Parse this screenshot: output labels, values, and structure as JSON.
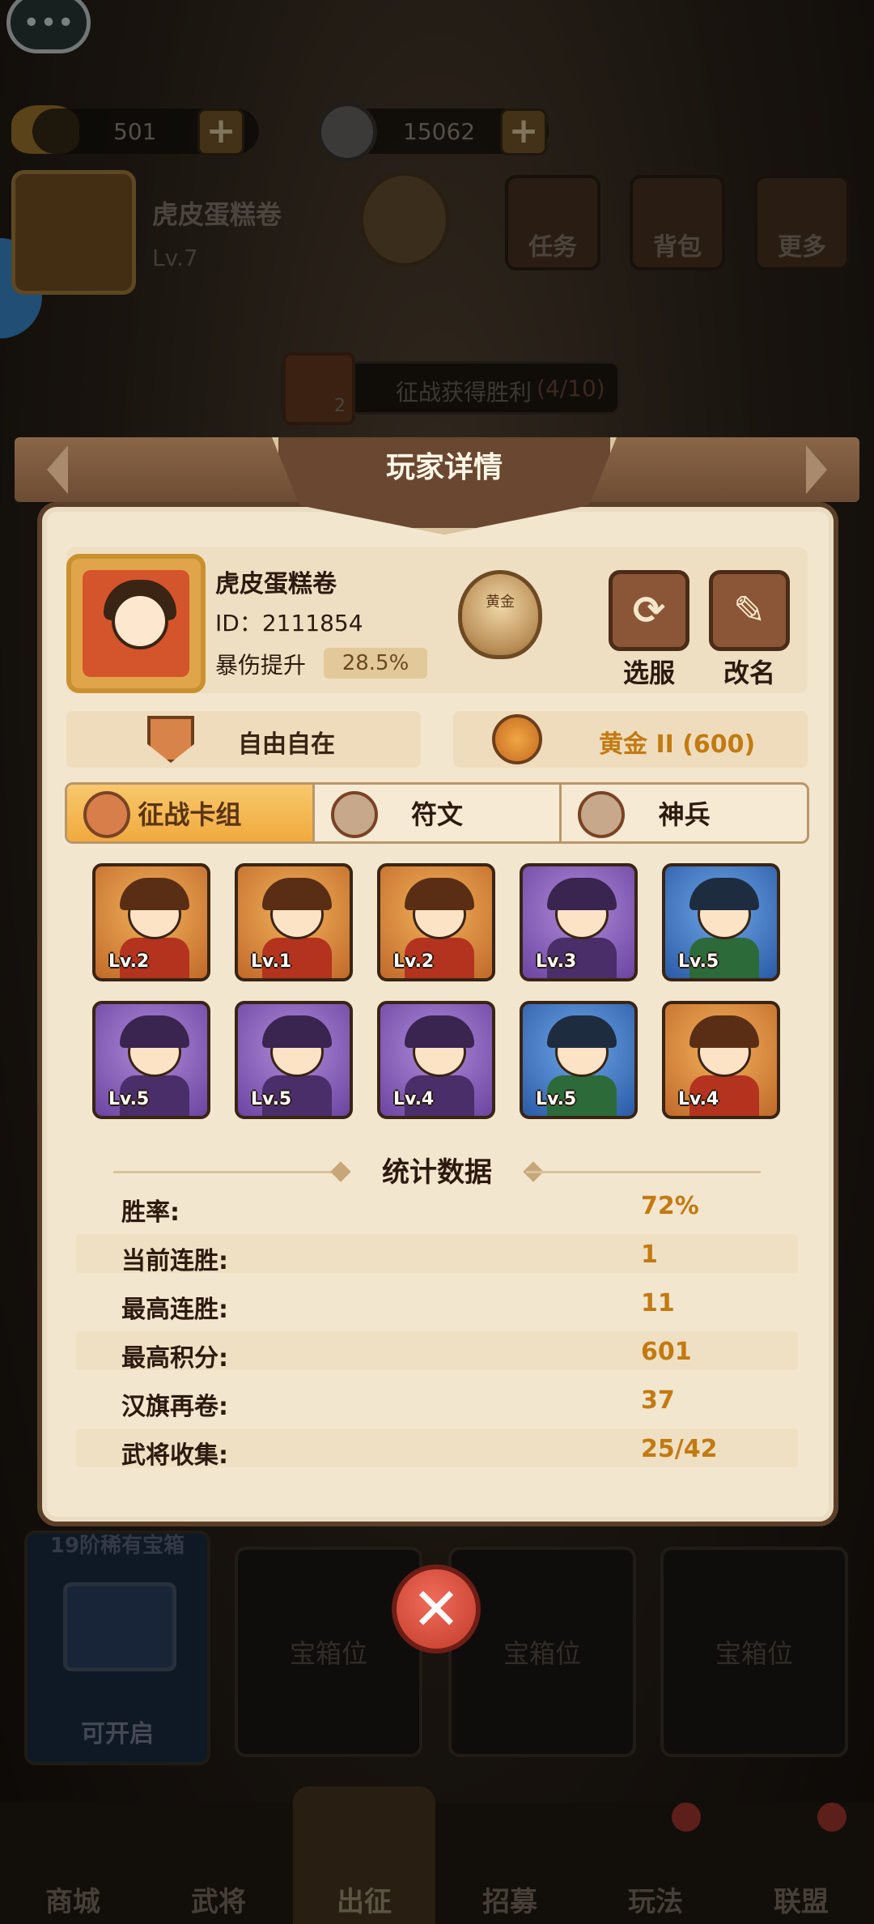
{
  "top": {
    "gold_amount": "501",
    "coin_amount": "15062",
    "player_name": "虎皮蛋糕卷",
    "player_level": "Lv.7",
    "rank_medal_text": "黄金",
    "buttons": [
      "任务",
      "背包",
      "更多"
    ],
    "quest_text": "征战获得胜利",
    "quest_progress": "(4/10)",
    "quest_badge": "2"
  },
  "dialog": {
    "title": "玩家详情",
    "profile": {
      "name": "虎皮蛋糕卷",
      "id": "ID：2111854",
      "stat_label": "暴伤提升",
      "stat_value": "28.5%",
      "medal_text": "黄金",
      "btn_server": "选服",
      "btn_rename": "改名"
    },
    "guild": "自由自在",
    "rank": "黄金 II (600)",
    "tabs": [
      "征战卡组",
      "符文",
      "神兵"
    ],
    "active_tab": 0,
    "cards": [
      {
        "level": "Lv.2",
        "rarity": "orange"
      },
      {
        "level": "Lv.1",
        "rarity": "orange"
      },
      {
        "level": "Lv.2",
        "rarity": "orange"
      },
      {
        "level": "Lv.3",
        "rarity": "purple"
      },
      {
        "level": "Lv.5",
        "rarity": "blue"
      },
      {
        "level": "Lv.5",
        "rarity": "purple"
      },
      {
        "level": "Lv.5",
        "rarity": "purple"
      },
      {
        "level": "Lv.4",
        "rarity": "purple"
      },
      {
        "level": "Lv.5",
        "rarity": "blue"
      },
      {
        "level": "Lv.4",
        "rarity": "orange"
      }
    ],
    "stats_title": "统计数据",
    "stats": [
      {
        "label": "胜率:",
        "value": "72%"
      },
      {
        "label": "当前连胜:",
        "value": "1"
      },
      {
        "label": "最高连胜:",
        "value": "11"
      },
      {
        "label": "最高积分:",
        "value": "601"
      },
      {
        "label": "汉旗再卷:",
        "value": "37"
      },
      {
        "label": "武将收集:",
        "value": "25/42"
      }
    ]
  },
  "bottom": {
    "chest_header": "19阶稀有宝箱",
    "chest_action": "可开启",
    "slots": [
      "宝箱位",
      "宝箱位",
      "宝箱位"
    ],
    "nav": [
      "商城",
      "武将",
      "出征",
      "招募",
      "玩法",
      "联盟"
    ]
  },
  "colors": {
    "accent_gold": "#c27a12",
    "tab_active": "#f0aa3e",
    "close_red": "#c23a2a"
  }
}
